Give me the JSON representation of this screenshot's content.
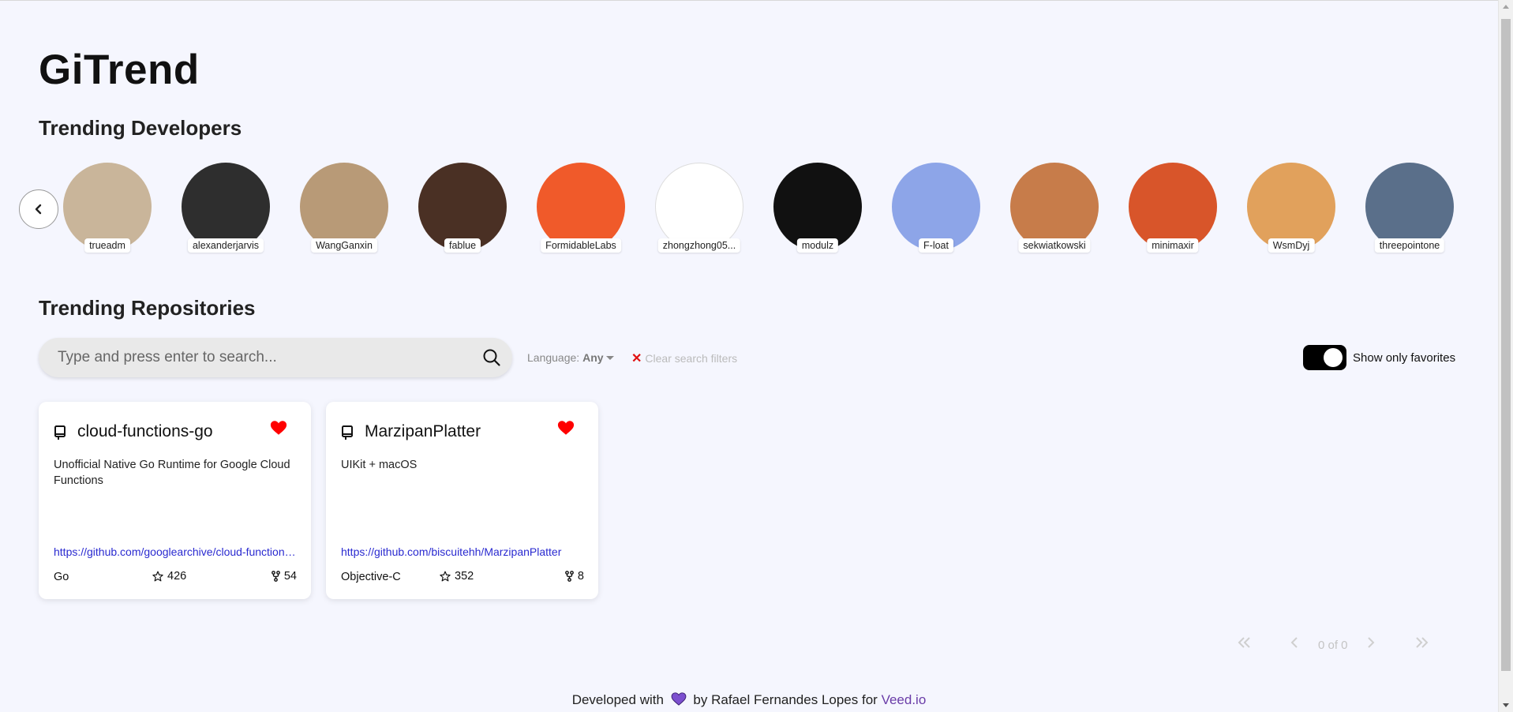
{
  "app": {
    "title": "GiTrend"
  },
  "developers": {
    "section_title": "Trending Developers",
    "items": [
      {
        "name": "trueadm",
        "avatar_color": "#c9b59a"
      },
      {
        "name": "alexanderjarvis",
        "avatar_color": "#2e2e2e"
      },
      {
        "name": "WangGanxin",
        "avatar_color": "#b89a77"
      },
      {
        "name": "fablue",
        "avatar_color": "#4a3024"
      },
      {
        "name": "FormidableLabs",
        "avatar_color": "#f05a2a"
      },
      {
        "name": "zhongzhong05...",
        "avatar_color": "#ffffff"
      },
      {
        "name": "modulz",
        "avatar_color": "#111111"
      },
      {
        "name": "F-loat",
        "avatar_color": "#8da5e8"
      },
      {
        "name": "sekwiatkowski",
        "avatar_color": "#c77c4a"
      },
      {
        "name": "minimaxir",
        "avatar_color": "#d8552a"
      },
      {
        "name": "WsmDyj",
        "avatar_color": "#e1a15c"
      },
      {
        "name": "threepointone",
        "avatar_color": "#5a6f8a"
      }
    ]
  },
  "repositories": {
    "section_title": "Trending Repositories",
    "search_placeholder": "Type and press enter to search...",
    "language_label": "Language:",
    "language_value": "Any",
    "clear_filters": "Clear search filters",
    "favorites_toggle_label": "Show only favorites",
    "items": [
      {
        "name": "cloud-functions-go",
        "description": "Unofficial Native Go Runtime for Google Cloud Functions",
        "url": "https://github.com/googlearchive/cloud-functions-go",
        "language": "Go",
        "stars": "426",
        "forks": "54"
      },
      {
        "name": "MarzipanPlatter",
        "description": "UIKit + macOS",
        "url": "https://github.com/biscuitehh/MarzipanPlatter",
        "language": "Objective-C",
        "stars": "352",
        "forks": "8"
      }
    ]
  },
  "pagination": {
    "status": "0 of 0"
  },
  "footer": {
    "prefix": "Developed with",
    "middle": "by Rafael Fernandes Lopes for",
    "link": "Veed.io"
  },
  "colors": {
    "heart": "#ff0000",
    "link": "#2a2ad0",
    "footer_heart": "#7c4fcf",
    "brand": "#6a3ca8"
  }
}
